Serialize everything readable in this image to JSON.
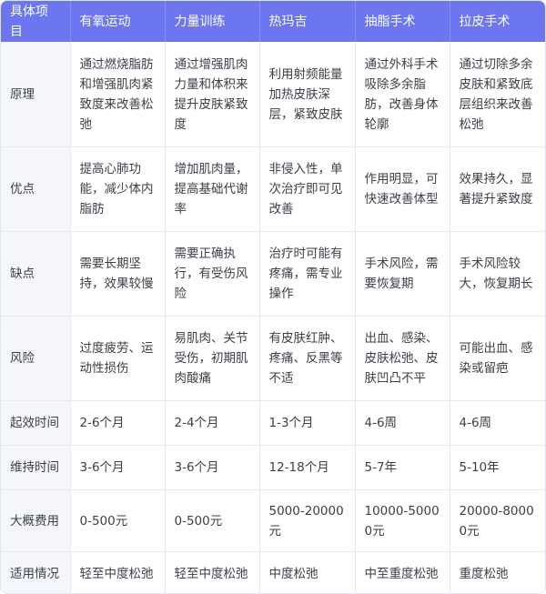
{
  "table": {
    "headers": [
      "具体项目",
      "有氧运动",
      "力量训练",
      "热玛吉",
      "抽脂手术",
      "拉皮手术"
    ],
    "rows": [
      [
        "原理",
        "通过燃烧脂肪和增强肌肉紧致度来改善松弛",
        "通过增强肌肉力量和体积来提升皮肤紧致度",
        "利用射频能量加热皮肤深层，紧致皮肤",
        "通过外科手术吸除多余脂肪，改善身体轮廓",
        "通过切除多余皮肤和紧致底层组织来改善松弛"
      ],
      [
        "优点",
        "提高心肺功能，减少体内脂肪",
        "增加肌肉量，提高基础代谢率",
        "非侵入性，单次治疗即可见改善",
        "作用明显，可快速改善体型",
        "效果持久，显著提升紧致度"
      ],
      [
        "缺点",
        "需要长期坚持，效果较慢",
        "需要正确执行，有受伤风险",
        "治疗时可能有疼痛，需专业操作",
        "手术风险，需要恢复期",
        "手术风险较大，恢复期长"
      ],
      [
        "风险",
        "过度疲劳、运动性损伤",
        "易肌肉、关节受伤，初期肌肉酸痛",
        "有皮肤红肿、疼痛、反黑等不适",
        "出血、感染、皮肤松弛、皮肤凹凸不平",
        "可能出血、感染或留疤"
      ],
      [
        "起效时间",
        "2-6个月",
        "2-4个月",
        "1-3个月",
        "4-6周",
        "4-6周"
      ],
      [
        "维持时间",
        "3-6个月",
        "3-6个月",
        "12-18个月",
        "5-7年",
        "5-10年"
      ],
      [
        "大概费用",
        "0-500元",
        "0-500元",
        "5000-20000元",
        "10000-50000元",
        "20000-80000元"
      ],
      [
        "适用情况",
        "轻至中度松弛",
        "轻至中度松弛",
        "中度松弛",
        "中至重度松弛",
        "重度松弛"
      ]
    ]
  }
}
